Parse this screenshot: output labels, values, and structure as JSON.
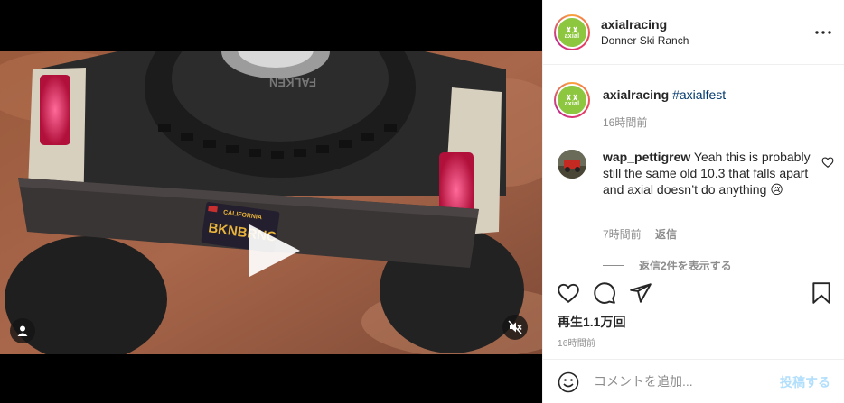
{
  "header": {
    "username": "axialracing",
    "location": "Donner Ski Ranch",
    "avatar_text": "axial"
  },
  "video": {
    "plate_state": "CALIFORNIA",
    "plate_text": "BKNBRNC",
    "tire_text": "FALKEN"
  },
  "caption": {
    "username": "axialracing",
    "hashtag": "#axialfest",
    "time": "16時間前"
  },
  "comment": {
    "username": "wap_pettigrew",
    "text": "Yeah this is probably still the same old 10.3 that falls apart and axial doesn’t do anything 😢",
    "time": "7時間前",
    "reply_label": "返信",
    "view_replies": "返信2件を表示する"
  },
  "stats": {
    "views": "再生1.1万回",
    "time": "16時間前"
  },
  "add_comment": {
    "placeholder": "コメントを追加...",
    "post_label": "投稿する"
  },
  "colors": {
    "brand_green": "#8dc63f",
    "link_blue": "#00376b",
    "post_disabled": "#b2dffc",
    "muted": "#8e8e8e"
  },
  "icons": [
    "play-icon",
    "tag-user-icon",
    "muted-speaker-icon",
    "more-icon",
    "heart-icon",
    "comment-icon",
    "share-icon",
    "bookmark-icon",
    "emoji-icon"
  ]
}
